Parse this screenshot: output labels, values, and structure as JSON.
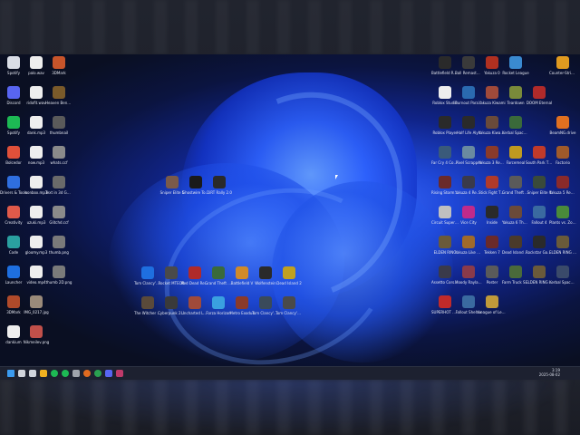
{
  "left_icons": [
    {
      "label": "Spotify",
      "name": "steam-like-icon",
      "color": "#d9dde6"
    },
    {
      "label": "palo.wav",
      "name": "audio-file-icon",
      "color": "#eeeeee"
    },
    {
      "label": "3DMark",
      "name": "app-icon",
      "color": "#c7542a"
    },
    {
      "label": "Discord",
      "name": "discord-icon",
      "color": "#5865f2"
    },
    {
      "label": "ridofit.wav",
      "name": "audio-file-icon",
      "color": "#eeeeee"
    },
    {
      "label": "Heaven Benchmark",
      "name": "app-icon",
      "color": "#7a5a2a"
    },
    {
      "label": "Spotify",
      "name": "spotify-icon",
      "color": "#1db954"
    },
    {
      "label": "dank.mp3",
      "name": "audio-file-icon",
      "color": "#eeeeee"
    },
    {
      "label": "thumbnail",
      "name": "image-file-icon",
      "color": "#5a5a5a"
    },
    {
      "label": "Bolcedor",
      "name": "app-icon",
      "color": "#e0503a"
    },
    {
      "label": "now.mp3",
      "name": "audio-file-icon",
      "color": "#eeeeee"
    },
    {
      "label": "whats.ccf",
      "name": "file-icon",
      "color": "#8a8a8a"
    },
    {
      "label": "Drivers & Tools",
      "name": "folder-icon",
      "color": "#2f6fe0"
    },
    {
      "label": "nonbox.mp3",
      "name": "audio-file-icon",
      "color": "#eeeeee"
    },
    {
      "label": "Text in 3d Games.mov",
      "name": "video-file-icon",
      "color": "#6a6a6a"
    },
    {
      "label": "Creativity",
      "name": "folder-icon",
      "color": "#e05a4a"
    },
    {
      "label": "uzuki.mp3",
      "name": "audio-file-icon",
      "color": "#eeeeee"
    },
    {
      "label": "Glitchd.ccf",
      "name": "file-icon",
      "color": "#8a8a8a"
    },
    {
      "label": "Code",
      "name": "app-icon",
      "color": "#2aa0a0"
    },
    {
      "label": "gloomy.mp3",
      "name": "audio-file-icon",
      "color": "#eeeeee"
    },
    {
      "label": "thumb.png",
      "name": "image-file-icon",
      "color": "#7a7a7a"
    },
    {
      "label": "Launcher",
      "name": "app-icon",
      "color": "#1e6fe0"
    },
    {
      "label": "video.mp4",
      "name": "video-file-icon",
      "color": "#eeeeee"
    },
    {
      "label": "thumb 2D.png",
      "name": "image-file-icon",
      "color": "#7a7a7a"
    },
    {
      "label": "3DMark",
      "name": "app-icon",
      "color": "#b04a2a"
    },
    {
      "label": "IMG_0217.jpg",
      "name": "image-file-icon",
      "color": "#9a8a7a"
    },
    {
      "label": "",
      "name": "blank-icon",
      "color": "rgba(0,0,0,0)"
    },
    {
      "label": "dankium",
      "name": "audio-file-icon",
      "color": "#eeeeee"
    },
    {
      "label": "Nikmeilev.png",
      "name": "image-file-icon",
      "color": "#c0504a"
    }
  ],
  "center_top_icons": [
    {
      "label": "Sniper Elite 5",
      "name": "game-icon",
      "color": "#7a5a4a"
    },
    {
      "label": "Ghostwire Tokyo",
      "name": "game-icon",
      "color": "#1a1a1a"
    },
    {
      "label": "DiRT Rally 2.0",
      "name": "game-icon",
      "color": "#2a2a2a"
    }
  ],
  "center_row1": [
    {
      "label": "Tom Clancy's Ghost Recon",
      "name": "uplay-icon",
      "color": "#1e6fe0"
    },
    {
      "label": "Rocket MTEOR",
      "name": "game-icon",
      "color": "#4a4a4a"
    },
    {
      "label": "Red Dead Redemption",
      "name": "game-icon",
      "color": "#b02a2a"
    },
    {
      "label": "Grand Theft Auto V",
      "name": "game-icon",
      "color": "#3a6a3a"
    },
    {
      "label": "Battlefield V",
      "name": "game-icon",
      "color": "#d08a2a"
    },
    {
      "label": "Wolfenstein",
      "name": "game-icon",
      "color": "#2a2a2a"
    },
    {
      "label": "Dead Island 2",
      "name": "game-icon",
      "color": "#c0a020"
    }
  ],
  "center_row2": [
    {
      "label": "The Witcher 3 Wild Hunt",
      "name": "game-icon",
      "color": "#5a4a3a"
    },
    {
      "label": "Cyberpunk 2077",
      "name": "game-icon",
      "color": "#3a3a3a"
    },
    {
      "label": "Uncharted Legacy",
      "name": "game-icon",
      "color": "#a04a3a"
    },
    {
      "label": "Forza Horizon",
      "name": "game-icon",
      "color": "#3aa0e0"
    },
    {
      "label": "Metro Exodus",
      "name": "game-icon",
      "color": "#8a3a2a"
    },
    {
      "label": "Tom Clancy's Breakpoint",
      "name": "game-icon",
      "color": "#3a4a5a"
    },
    {
      "label": "Tom Clancy's Ghost Recon",
      "name": "game-icon",
      "color": "#4a4a4a"
    }
  ],
  "right_icons": [
    {
      "label": "Battlefield Remastered",
      "name": "game-icon",
      "color": "#2a2a2a"
    },
    {
      "label": "Ball Remastered",
      "name": "game-icon",
      "color": "#3a3a3a"
    },
    {
      "label": "Yakuza 0",
      "name": "game-icon",
      "color": "#b03020"
    },
    {
      "label": "Rocket League",
      "name": "game-icon",
      "color": "#3a8ad0"
    },
    {
      "label": "",
      "name": "blank-icon",
      "color": "rgba(0,0,0,0)"
    },
    {
      "label": "Counter-Strike 2",
      "name": "game-icon",
      "color": "#e09a20"
    },
    {
      "label": "Roblox Studio",
      "name": "game-icon",
      "color": "#eeeeee"
    },
    {
      "label": "Burnout Paradise",
      "name": "game-icon",
      "color": "#2a6ab0"
    },
    {
      "label": "Yakuza Kiwami",
      "name": "game-icon",
      "color": "#a04a3a"
    },
    {
      "label": "Teardown",
      "name": "game-icon",
      "color": "#7a8a3a"
    },
    {
      "label": "DOOM Eternal",
      "name": "game-icon",
      "color": "#b02a2a"
    },
    {
      "label": "",
      "name": "blank-icon",
      "color": "rgba(0,0,0,0)"
    },
    {
      "label": "Roblox Player",
      "name": "game-icon",
      "color": "#2a2a2a"
    },
    {
      "label": "Half Life Alyx",
      "name": "game-icon",
      "color": "#2a2a2a"
    },
    {
      "label": "Yakuza Kiwami 2",
      "name": "game-icon",
      "color": "#6a4a3a"
    },
    {
      "label": "Kerbal Space Program",
      "name": "game-icon",
      "color": "#3a6a3a"
    },
    {
      "label": "",
      "name": "blank-icon",
      "color": "rgba(0,0,0,0)"
    },
    {
      "label": "BeamNG.drive",
      "name": "game-icon",
      "color": "#e07020"
    },
    {
      "label": "Far Cry 4 Complete",
      "name": "game-icon",
      "color": "#3a5a7a"
    },
    {
      "label": "Pixel Scrapper",
      "name": "game-icon",
      "color": "#6a8aa0"
    },
    {
      "label": "Yakuza 3 Remastered",
      "name": "game-icon",
      "color": "#8a3a2a"
    },
    {
      "label": "Farcemeal",
      "name": "game-icon",
      "color": "#c09a20"
    },
    {
      "label": "South Park The Stick",
      "name": "game-icon",
      "color": "#c03a2a"
    },
    {
      "label": "Factorio",
      "name": "game-icon",
      "color": "#a05a2a"
    },
    {
      "label": "Rising Storm 2 Vietnam",
      "name": "game-icon",
      "color": "#6a2a2a"
    },
    {
      "label": "Yakuza 4 Remastered",
      "name": "game-icon",
      "color": "#3a3a4a"
    },
    {
      "label": "Stick Fight The Game",
      "name": "game-icon",
      "color": "#b03a2a"
    },
    {
      "label": "Grand Theft Auto San",
      "name": "game-icon",
      "color": "#5a5a5a"
    },
    {
      "label": "Sniper Elite 4",
      "name": "game-icon",
      "color": "#3a4a3a"
    },
    {
      "label": "Yakuza 5 Remastered",
      "name": "game-icon",
      "color": "#8a2a2a"
    },
    {
      "label": "Circuit Superstars",
      "name": "game-icon",
      "color": "#c0c0c0"
    },
    {
      "label": "Vice City",
      "name": "game-icon",
      "color": "#c02a8a"
    },
    {
      "label": "Inside",
      "name": "game-icon",
      "color": "#2a2a2a"
    },
    {
      "label": "Yakuza 6 The Song of Life",
      "name": "game-icon",
      "color": "#6a4a3a"
    },
    {
      "label": "Fallout 4",
      "name": "game-icon",
      "color": "#3a6aa0"
    },
    {
      "label": "Plants vs. Zombies",
      "name": "game-icon",
      "color": "#4a8a3a"
    },
    {
      "label": "ELDEN RING",
      "name": "game-icon",
      "color": "#6a5a3a"
    },
    {
      "label": "Yakuza Like a Dragon",
      "name": "game-icon",
      "color": "#a06a2a"
    },
    {
      "label": "Tekken 7",
      "name": "game-icon",
      "color": "#6a2a2a"
    },
    {
      "label": "Dead Island Definitive",
      "name": "game-icon",
      "color": "#4a3a2a"
    },
    {
      "label": "Rockstar Games",
      "name": "game-icon",
      "color": "#2a2a2a"
    },
    {
      "label": "ELDEN RING Adventure",
      "name": "game-icon",
      "color": "#6a5a3a"
    },
    {
      "label": "Assetto Corsa Competizione",
      "name": "game-icon",
      "color": "#3a3a4a"
    },
    {
      "label": "Moody Rayland",
      "name": "game-icon",
      "color": "#8a3a4a"
    },
    {
      "label": "Poster",
      "name": "game-icon",
      "color": "#5a5a5a"
    },
    {
      "label": "Farm Truck Simulator",
      "name": "game-icon",
      "color": "#4a6a3a"
    },
    {
      "label": "ELDEN RING ArtBook",
      "name": "game-icon",
      "color": "#6a5a3a"
    },
    {
      "label": "Kerbal Space Program 2",
      "name": "game-icon",
      "color": "#3a4a6a"
    },
    {
      "label": "SUPERHOT MIND C",
      "name": "game-icon",
      "color": "#c02a2a"
    },
    {
      "label": "Fallout Shelter",
      "name": "game-icon",
      "color": "#3a6aa0"
    },
    {
      "label": "League of Legends",
      "name": "game-icon",
      "color": "#c09a3a"
    }
  ],
  "taskbar": {
    "items": [
      {
        "name": "start-icon",
        "color": "#3a9af0"
      },
      {
        "name": "search-icon",
        "color": "#d0d4dc"
      },
      {
        "name": "task-view-icon",
        "color": "#d0d4dc"
      },
      {
        "name": "file-explorer-icon",
        "color": "#f0b020"
      },
      {
        "name": "spotify-icon",
        "color": "#1db954"
      },
      {
        "name": "spotify-icon",
        "color": "#1db954"
      },
      {
        "name": "settings-icon",
        "color": "#a0a4ac"
      },
      {
        "name": "firefox-icon",
        "color": "#e06a20"
      },
      {
        "name": "chrome-icon",
        "color": "#2aa050"
      },
      {
        "name": "discord-icon",
        "color": "#5865f2"
      },
      {
        "name": "app-icon",
        "color": "#c03a6a"
      }
    ],
    "time": "3:19",
    "date": "2025-08-02"
  }
}
